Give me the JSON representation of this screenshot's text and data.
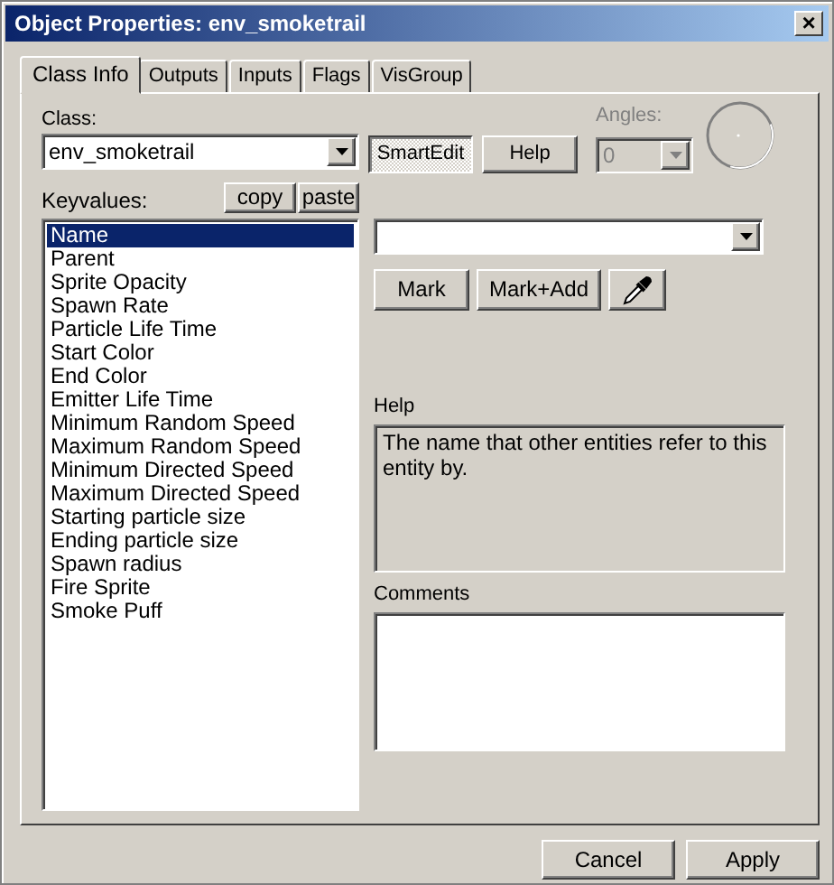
{
  "window": {
    "title": "Object Properties: env_smoketrail",
    "close": "×"
  },
  "tabs": [
    {
      "label": "Class Info",
      "selected": true
    },
    {
      "label": "Outputs",
      "selected": false
    },
    {
      "label": "Inputs",
      "selected": false
    },
    {
      "label": "Flags",
      "selected": false
    },
    {
      "label": "VisGroup",
      "selected": false
    }
  ],
  "class_label": "Class:",
  "class_value": "env_smoketrail",
  "smartedit": {
    "label": "SmartEdit",
    "pressed": true
  },
  "help_button": "Help",
  "angles": {
    "label": "Angles:",
    "value": "0",
    "disabled": true
  },
  "keyvalues_label": "Keyvalues:",
  "copy_button": "copy",
  "paste_button": "paste",
  "keyvalues": [
    {
      "label": "Name",
      "selected": true
    },
    {
      "label": "Parent",
      "selected": false
    },
    {
      "label": "Sprite Opacity",
      "selected": false
    },
    {
      "label": "Spawn Rate",
      "selected": false
    },
    {
      "label": "Particle Life Time",
      "selected": false
    },
    {
      "label": "Start Color",
      "selected": false
    },
    {
      "label": "End Color",
      "selected": false
    },
    {
      "label": "Emitter Life Time",
      "selected": false
    },
    {
      "label": "Minimum Random Speed",
      "selected": false
    },
    {
      "label": "Maximum Random Speed",
      "selected": false
    },
    {
      "label": "Minimum Directed Speed",
      "selected": false
    },
    {
      "label": "Maximum Directed Speed",
      "selected": false
    },
    {
      "label": "Starting particle size",
      "selected": false
    },
    {
      "label": "Ending particle size",
      "selected": false
    },
    {
      "label": "Spawn radius",
      "selected": false
    },
    {
      "label": "Fire Sprite",
      "selected": false
    },
    {
      "label": "Smoke Puff",
      "selected": false
    }
  ],
  "mark_buttons": [
    "Mark",
    "Mark+Add"
  ],
  "help": {
    "label": "Help",
    "text": "The name that other entities refer to this entity by."
  },
  "comments": {
    "label": "Comments"
  },
  "buttons": [
    "Cancel",
    "Apply"
  ]
}
